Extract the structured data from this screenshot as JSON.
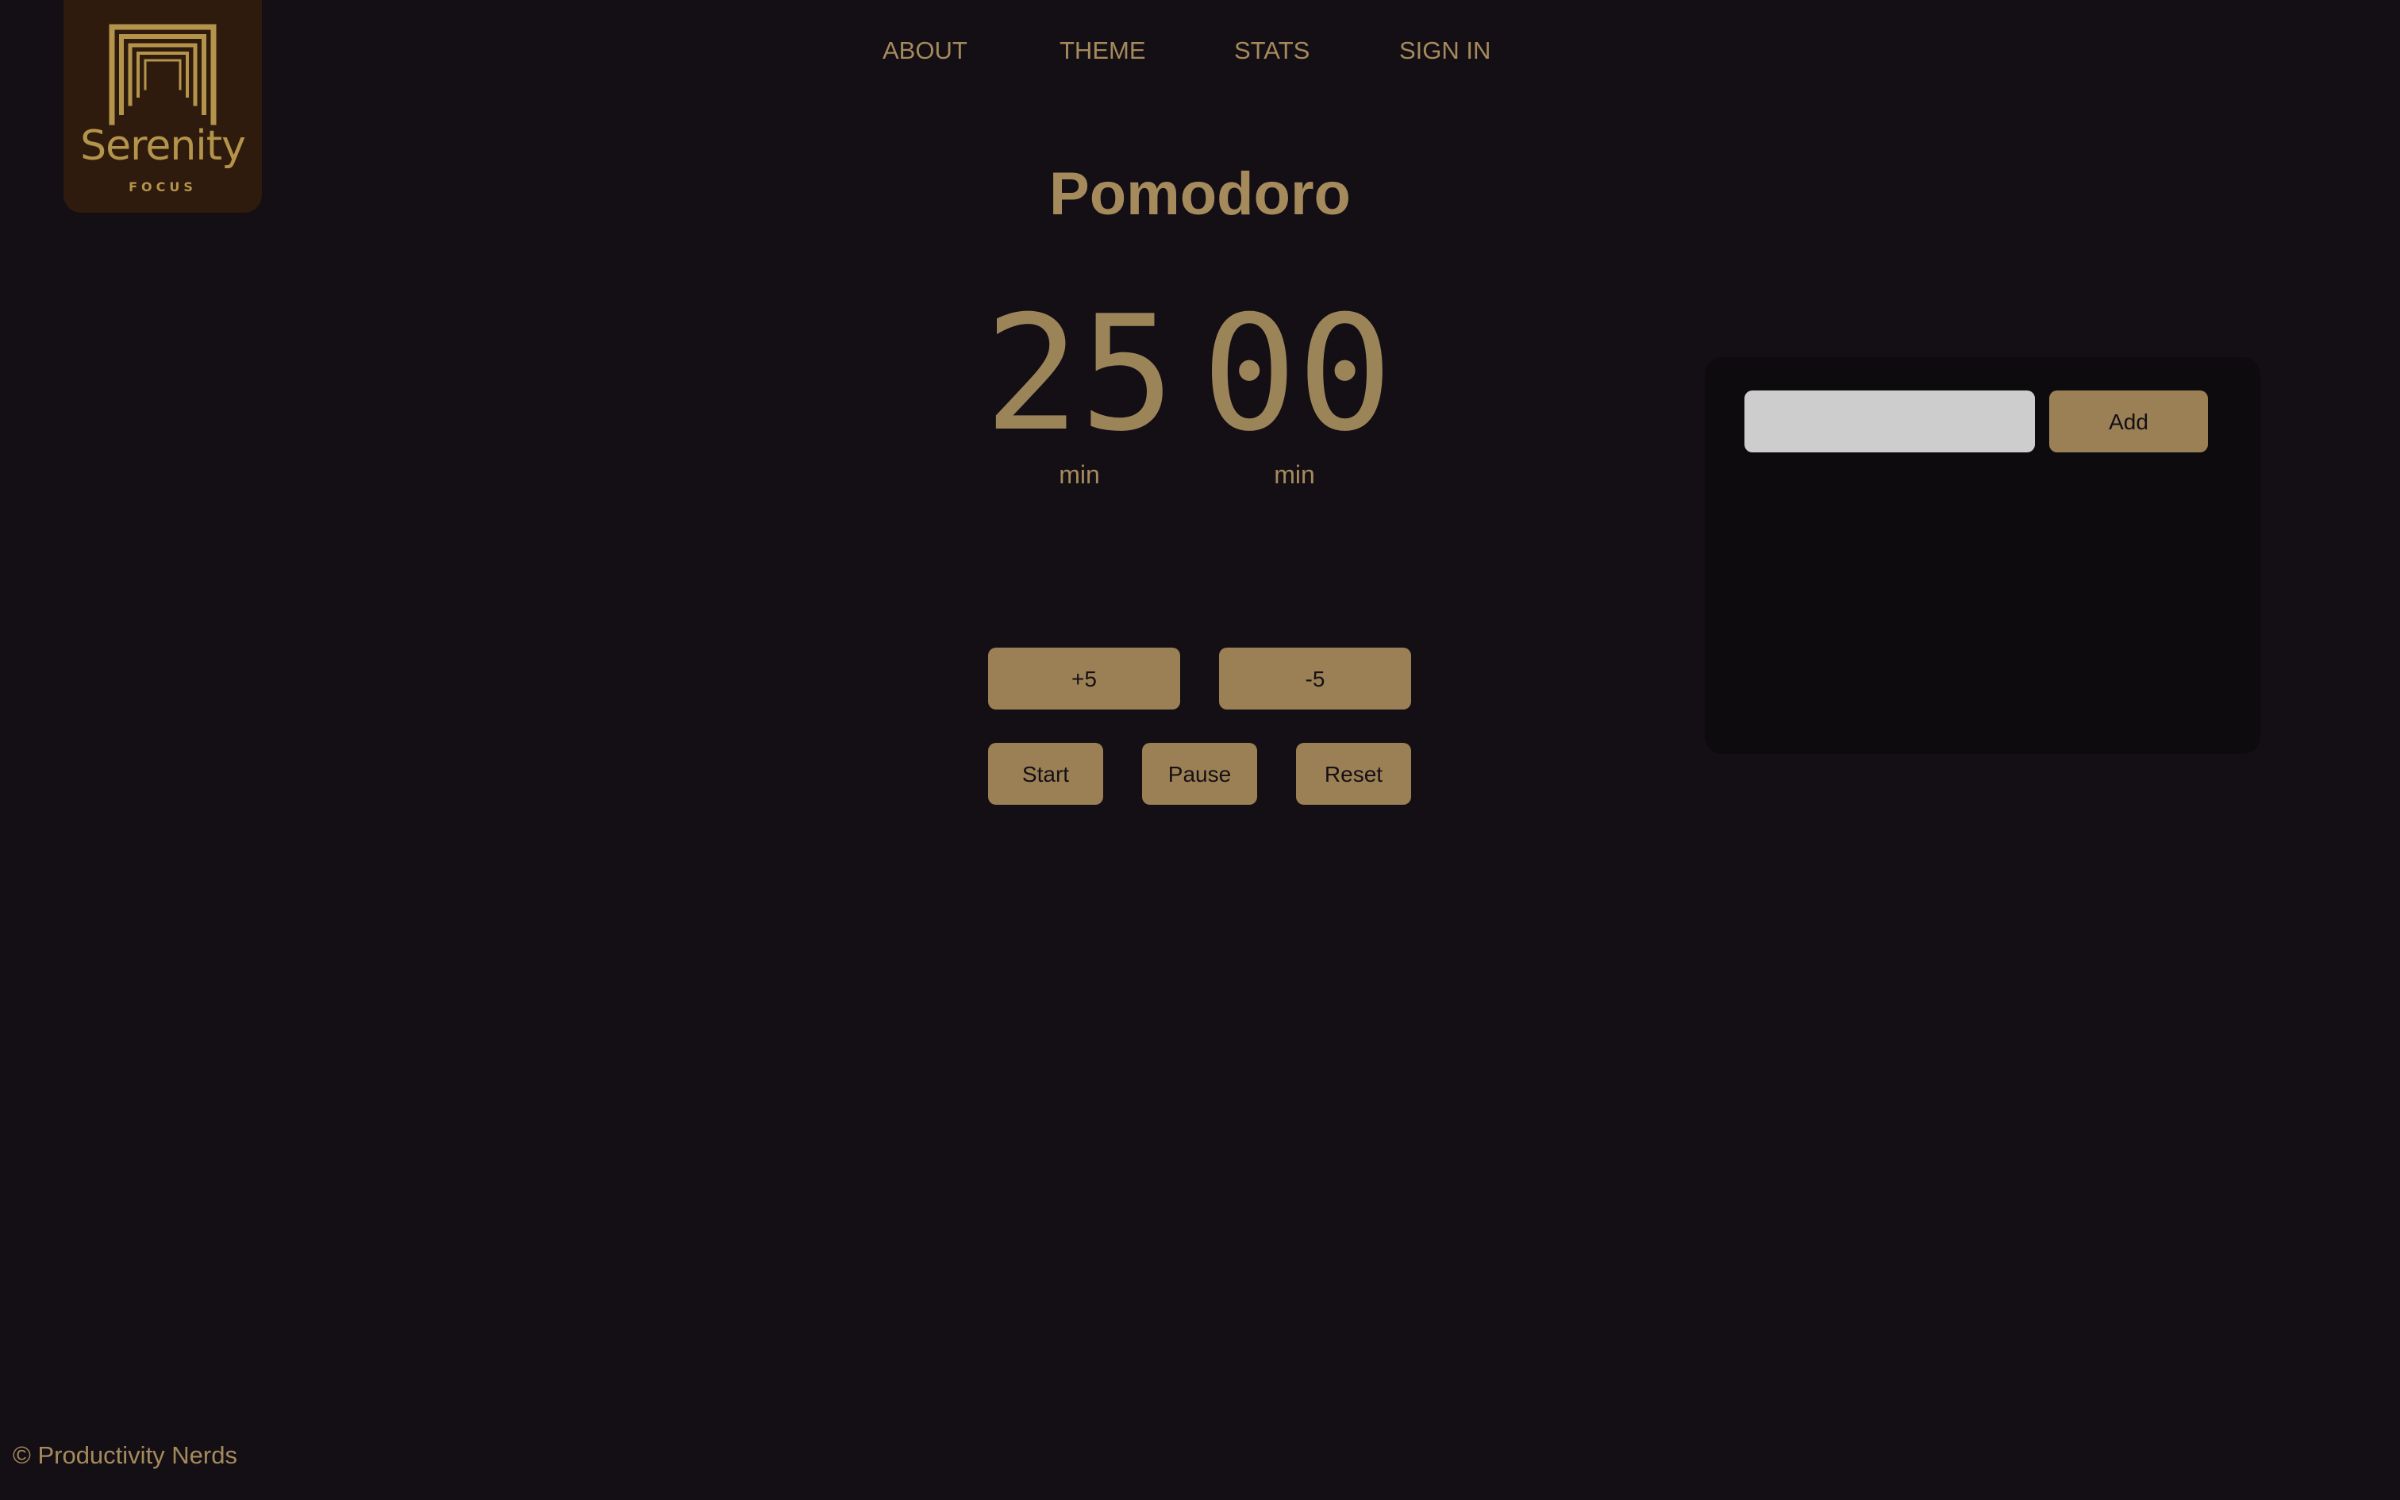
{
  "logo": {
    "wordmark": "Serenity",
    "tagline": "FOCUS"
  },
  "nav": {
    "about": "ABOUT",
    "theme": "THEME",
    "stats": "STATS",
    "sign_in": "SIGN IN"
  },
  "page": {
    "title": "Pomodoro"
  },
  "timer": {
    "minutes": "25",
    "seconds": "00",
    "minutes_unit": "min",
    "seconds_unit": "min"
  },
  "controls": {
    "plus_five": "+5",
    "minus_five": "-5",
    "start": "Start",
    "pause": "Pause",
    "reset": "Reset"
  },
  "tasks": {
    "input_value": "",
    "add_label": "Add"
  },
  "footer": {
    "copyright": "© Productivity Nerds"
  },
  "colors": {
    "background": "#140e15",
    "accent": "#9b8055",
    "text": "#a58a5c",
    "logo_bg": "#2e1b0d",
    "logo_gold": "#b4944b",
    "panel_bg": "#0e0b0e",
    "input_bg": "#cdcdcd"
  }
}
